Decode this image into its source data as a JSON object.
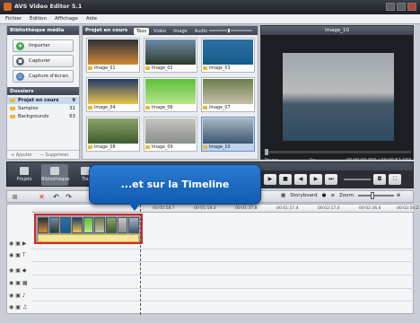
{
  "window": {
    "title": "AVS Video Editor 5.1"
  },
  "menu": [
    "Fichier",
    "Édition",
    "Affichage",
    "Aide"
  ],
  "library": {
    "header": "Bibliothèque média",
    "buttons": [
      "Importer",
      "Capturer",
      "Capture d'écran"
    ],
    "folders_header": "Dossiers",
    "folders": [
      {
        "name": "Projet en cours",
        "count": "9"
      },
      {
        "name": "Samples",
        "count": "31"
      },
      {
        "name": "Backgrounds",
        "count": "63"
      }
    ],
    "add_label": "+ Ajouter",
    "remove_label": "— Supprimer"
  },
  "media": {
    "header": "Projet en cours",
    "tabs": [
      "Tous",
      "Vidéo",
      "Image",
      "Audio"
    ],
    "thumbs": [
      {
        "label": "Image_01",
        "color_top": "#2a2f36",
        "color_bottom": "#d18a3a"
      },
      {
        "label": "Image_02",
        "color_top": "#6d8da8",
        "color_bottom": "#2c3b2a"
      },
      {
        "label": "Image_03",
        "color_top": "#2c6fa3",
        "color_bottom": "#175b89"
      },
      {
        "label": "Image_04",
        "color_top": "#223a6a",
        "color_bottom": "#e9c44a"
      },
      {
        "label": "Image_06",
        "color_top": "#5ec13b",
        "color_bottom": "#b7e48a"
      },
      {
        "label": "Image_07",
        "color_top": "#6d7c4e",
        "color_bottom": "#c6c2a8"
      },
      {
        "label": "Image_08",
        "color_top": "#8ba36a",
        "color_bottom": "#3f5a2c"
      },
      {
        "label": "Image_09",
        "color_top": "#c5c6c1",
        "color_bottom": "#8a8d88"
      },
      {
        "label": "Image_10",
        "color_top": "#a8b6c3",
        "color_bottom": "#3c5770"
      }
    ]
  },
  "preview": {
    "title": "Image_10",
    "state": "Pause",
    "speed": "1x",
    "time": "00:00:00.000 / 00:00:52.033"
  },
  "midbar": {
    "buttons": [
      "Projets",
      "Bibliothèque",
      "Tra"
    ]
  },
  "timeline_toolbar": {
    "storyboard_label": "Storyboard",
    "zoom_label": "Zoom:"
  },
  "ruler": [
    "00:00:58.7",
    "00:01:18.3",
    "00:01:37.8",
    "00:01:57.4",
    "00:02:17.0",
    "00:02:36.6",
    "00:02:56.2"
  ],
  "callout": {
    "text": "...et sur la Timeline"
  },
  "colors": {
    "accent": "#0f5bb1",
    "highlight": "#d22222"
  }
}
